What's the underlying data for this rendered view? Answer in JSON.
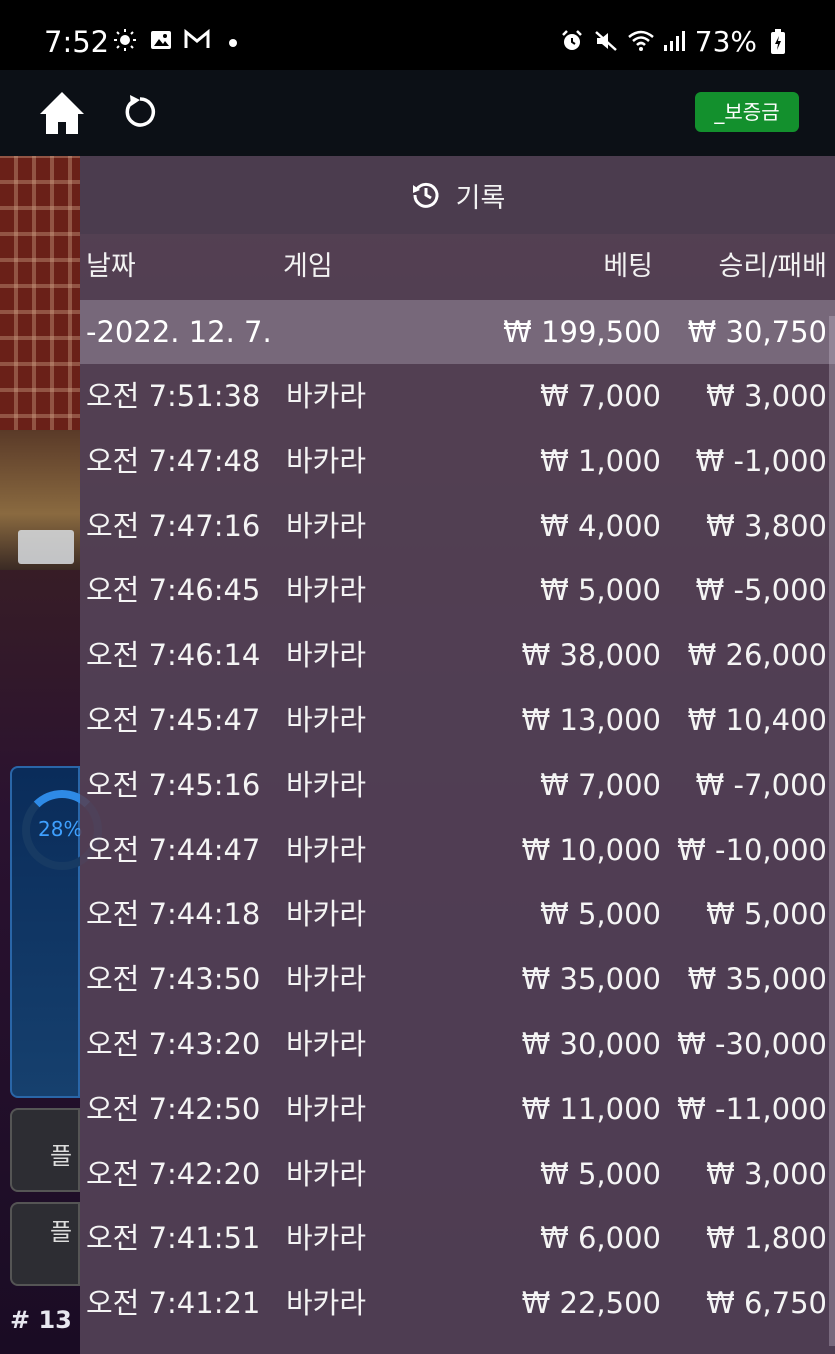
{
  "status_bar": {
    "time": "7:52",
    "battery": "73%",
    "left_icons": [
      "weather-sun-icon",
      "gallery-icon",
      "gmail-icon",
      "notification-dot-icon"
    ],
    "right_icons": [
      "alarm-icon",
      "mute-icon",
      "wifi-icon",
      "signal-icon",
      "battery-icon"
    ]
  },
  "app_bar": {
    "deposit_label": "_보증금"
  },
  "background": {
    "progress_percent": "28%",
    "side_button_1": "플",
    "side_button_2": "플",
    "round_label": "# 13"
  },
  "history": {
    "title": "기록",
    "columns": {
      "date": "날짜",
      "game": "게임",
      "bet": "베팅",
      "result": "승리/패배"
    },
    "date_group": {
      "date": "-2022. 12. 7.",
      "total_bet": "₩ 199,500",
      "total_result": "₩ 30,750"
    },
    "rows": [
      {
        "time": "오전 7:51:38",
        "game": "바카라",
        "bet": "₩ 7,000",
        "result": "₩ 3,000"
      },
      {
        "time": "오전 7:47:48",
        "game": "바카라",
        "bet": "₩ 1,000",
        "result": "₩ -1,000"
      },
      {
        "time": "오전 7:47:16",
        "game": "바카라",
        "bet": "₩ 4,000",
        "result": "₩ 3,800"
      },
      {
        "time": "오전 7:46:45",
        "game": "바카라",
        "bet": "₩ 5,000",
        "result": "₩ -5,000"
      },
      {
        "time": "오전 7:46:14",
        "game": "바카라",
        "bet": "₩ 38,000",
        "result": "₩ 26,000"
      },
      {
        "time": "오전 7:45:47",
        "game": "바카라",
        "bet": "₩ 13,000",
        "result": "₩ 10,400"
      },
      {
        "time": "오전 7:45:16",
        "game": "바카라",
        "bet": "₩ 7,000",
        "result": "₩ -7,000"
      },
      {
        "time": "오전 7:44:47",
        "game": "바카라",
        "bet": "₩ 10,000",
        "result": "₩ -10,000"
      },
      {
        "time": "오전 7:44:18",
        "game": "바카라",
        "bet": "₩ 5,000",
        "result": "₩ 5,000"
      },
      {
        "time": "오전 7:43:50",
        "game": "바카라",
        "bet": "₩ 35,000",
        "result": "₩ 35,000"
      },
      {
        "time": "오전 7:43:20",
        "game": "바카라",
        "bet": "₩ 30,000",
        "result": "₩ -30,000"
      },
      {
        "time": "오전 7:42:50",
        "game": "바카라",
        "bet": "₩ 11,000",
        "result": "₩ -11,000"
      },
      {
        "time": "오전 7:42:20",
        "game": "바카라",
        "bet": "₩ 5,000",
        "result": "₩ 3,000"
      },
      {
        "time": "오전 7:41:51",
        "game": "바카라",
        "bet": "₩ 6,000",
        "result": "₩ 1,800"
      },
      {
        "time": "오전 7:41:21",
        "game": "바카라",
        "bet": "₩ 22,500",
        "result": "₩ 6,750"
      }
    ]
  }
}
